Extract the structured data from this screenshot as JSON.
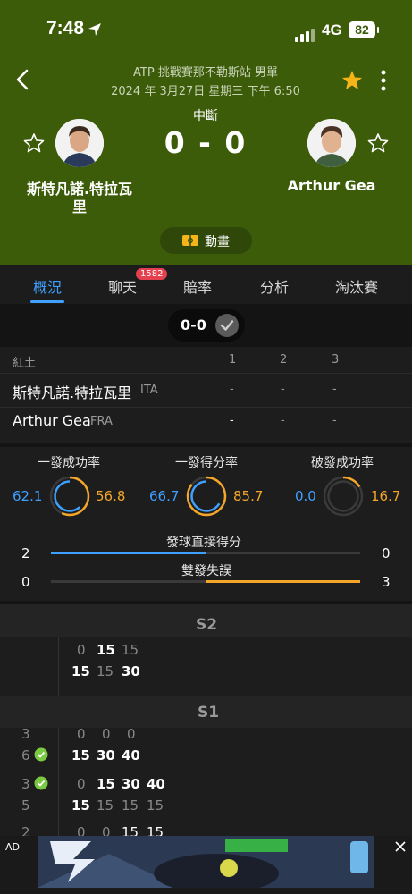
{
  "status_bar": {
    "time": "7:48",
    "network": "4G",
    "battery": "82"
  },
  "match": {
    "event": "ATP 挑戰賽那不勒斯站 男單",
    "datetime": "2024 年 3月27日 星期三 下午 6:50",
    "status": "中斷",
    "score": "0 - 0",
    "player1": {
      "name_line1": "斯特凡諾.特拉瓦",
      "name_line2": "里"
    },
    "player2": {
      "name": "Arthur Gea"
    },
    "animation_label": "動畫"
  },
  "tabs": [
    {
      "label": "概況"
    },
    {
      "label": "聊天"
    },
    {
      "label": "賠率"
    },
    {
      "label": "分析"
    },
    {
      "label": "淘汰賽"
    }
  ],
  "chat_badge": "1582",
  "set_pill": {
    "label": "0-0"
  },
  "score_table": {
    "surface": "紅土",
    "set_headers": [
      "1",
      "2",
      "3"
    ],
    "rows": [
      {
        "name": "斯特凡諾.特拉瓦里",
        "country": "ITA",
        "sets": [
          "-",
          "-",
          "-"
        ]
      },
      {
        "name": "Arthur Gea",
        "country": "FRA",
        "sets": [
          "-",
          "-",
          "-"
        ]
      }
    ]
  },
  "stats": {
    "first_serve": {
      "label": "一發成功率",
      "p1": "62.1",
      "p2": "56.8"
    },
    "first_serve_points": {
      "label": "一發得分率",
      "p1": "66.7",
      "p2": "85.7"
    },
    "break_points": {
      "label": "破發成功率",
      "p1": "0.0",
      "p2": "16.7"
    },
    "aces": {
      "label": "發球直接得分",
      "p1": "2",
      "p2": "0",
      "p1_share": 1.0,
      "p2_share": 0.0
    },
    "double_faults": {
      "label": "雙發失誤",
      "p1": "0",
      "p2": "3",
      "p1_share": 0.0,
      "p2_share": 1.0
    }
  },
  "pbp": {
    "s2_label": "S2",
    "s2_rows": [
      [
        "0",
        "15",
        "15"
      ],
      [
        "15",
        "15",
        "30"
      ]
    ],
    "s1_label": "S1",
    "s1_game1": {
      "p1_games": "3",
      "p2_games": "6",
      "p1_points": [
        "0",
        "0",
        "0"
      ],
      "p2_points": [
        "15",
        "30",
        "40"
      ]
    },
    "s1_game2": {
      "p1_games": "3",
      "p2_games": "5",
      "p1_points": [
        "0",
        "15",
        "30",
        "40"
      ],
      "p2_points": [
        "15",
        "15",
        "15",
        "15"
      ]
    },
    "s1_game3_partial": {
      "p1_games": "2",
      "p1_points": [
        "0",
        "0",
        "15",
        "15"
      ]
    }
  },
  "ad": {
    "label": "AD"
  },
  "colors": {
    "header_green": "#3d5c0a",
    "accent_blue": "#3fa0ff",
    "accent_orange": "#f4a62a",
    "star_yellow": "#f4b41a",
    "badge_red": "#e5404e"
  }
}
